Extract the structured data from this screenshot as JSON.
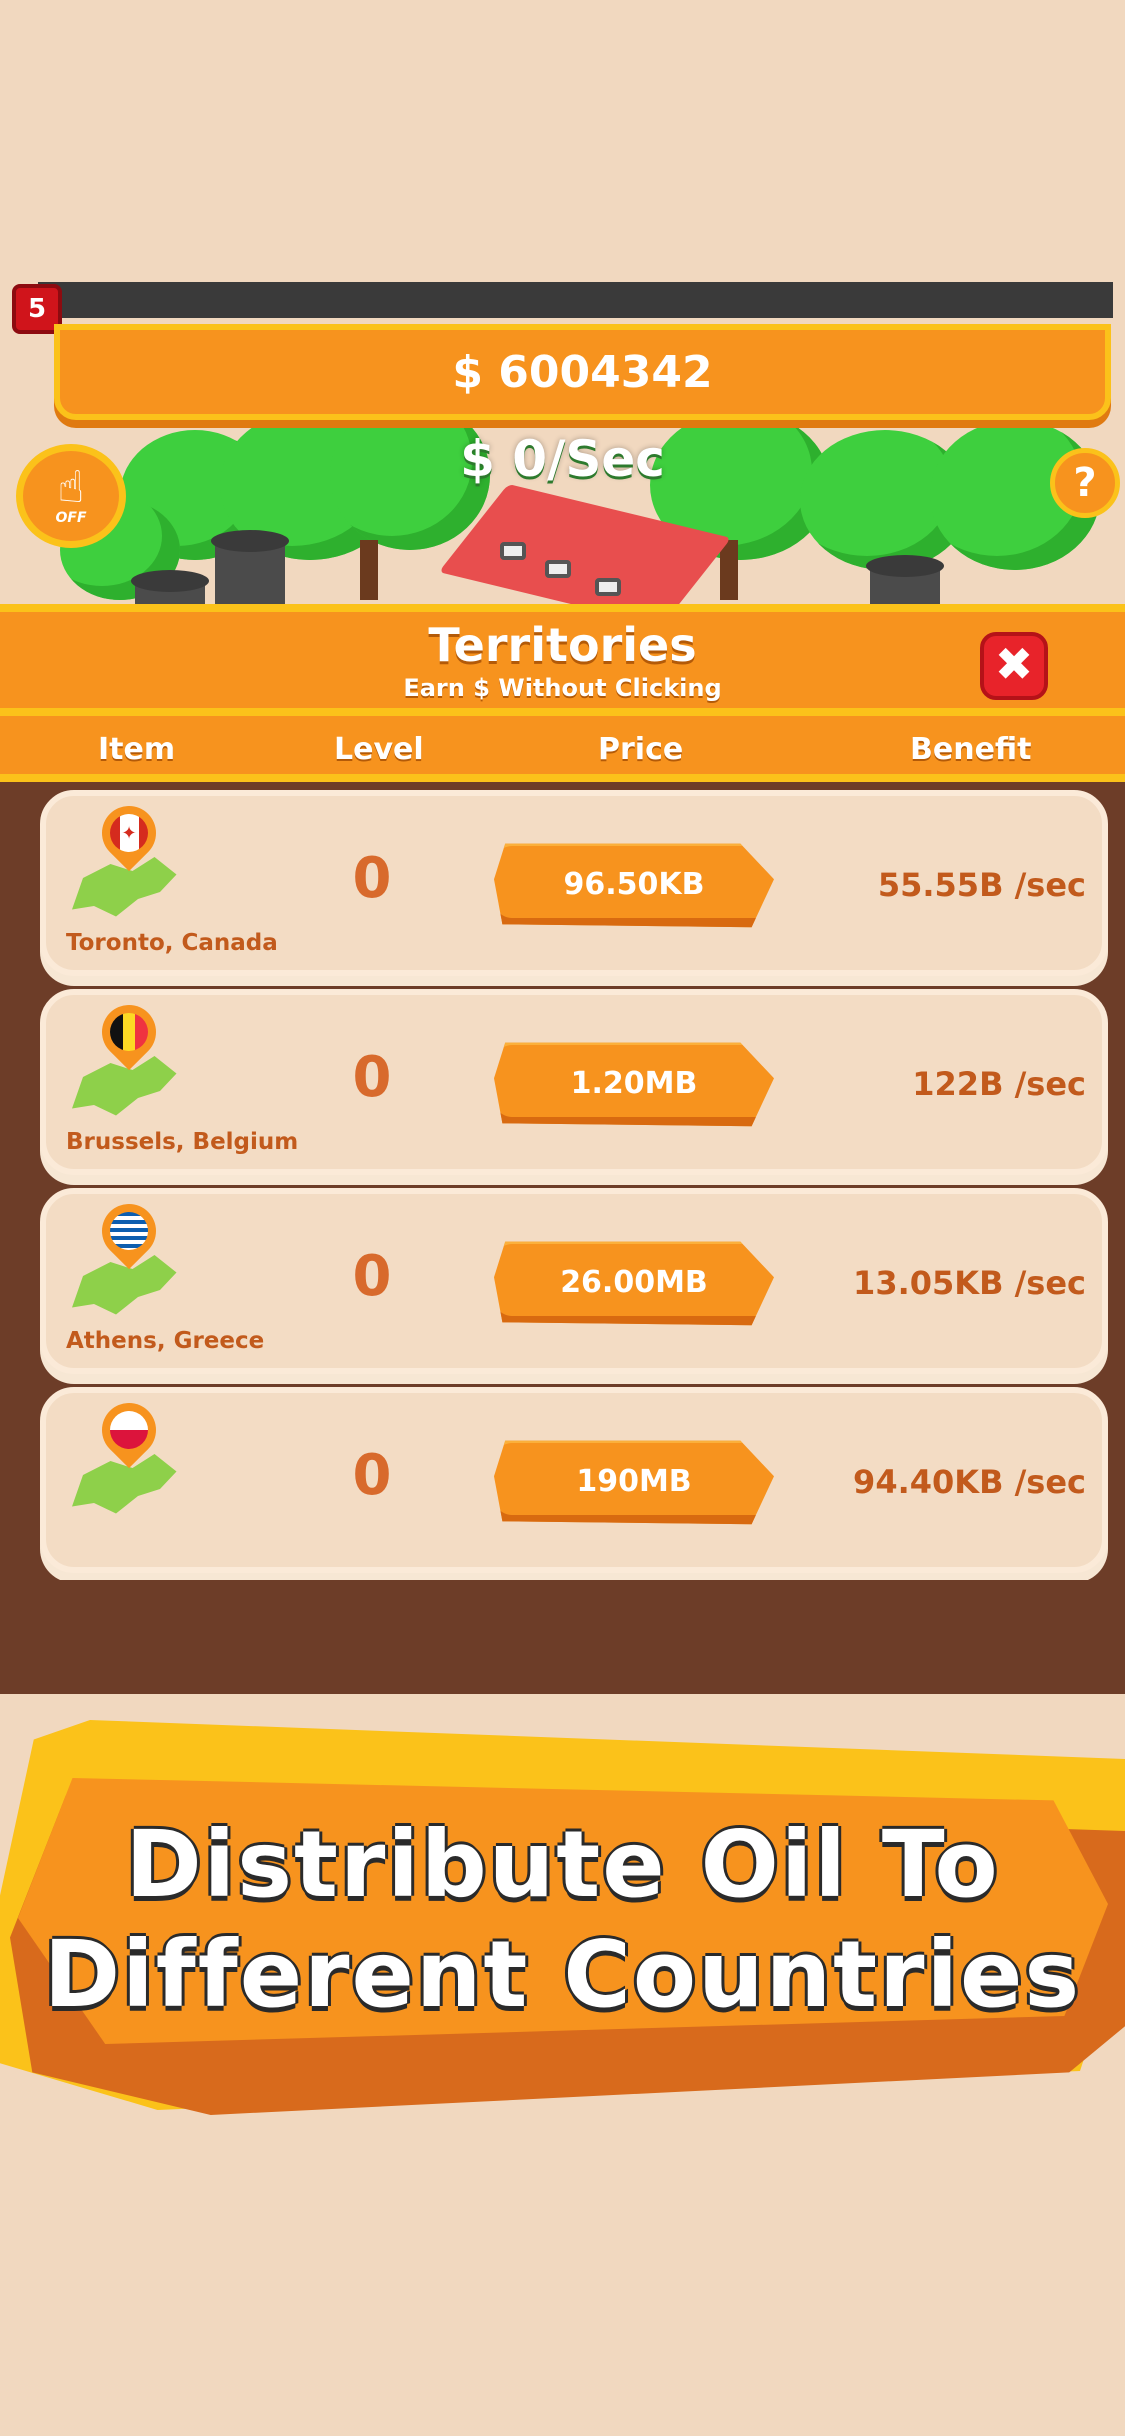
{
  "hud": {
    "level": "5",
    "money": "$ 6004342",
    "rate": "$ 0/Sec",
    "auto_click_state": "OFF",
    "help_label": "?"
  },
  "panel": {
    "title": "Territories",
    "subtitle": "Earn $ Without Clicking",
    "close_label": "✖",
    "columns": {
      "item": "Item",
      "level": "Level",
      "price": "Price",
      "benefit": "Benefit"
    }
  },
  "territories": [
    {
      "city": "Toronto, Canada",
      "level": "0",
      "price": "96.50KB",
      "benefit": "55.55B /sec",
      "flag": "canada"
    },
    {
      "city": "Brussels, Belgium",
      "level": "0",
      "price": "1.20MB",
      "benefit": "122B /sec",
      "flag": "belgium"
    },
    {
      "city": "Athens, Greece",
      "level": "0",
      "price": "26.00MB",
      "benefit": "13.05KB /sec",
      "flag": "greece"
    },
    {
      "city": "",
      "level": "0",
      "price": "190MB",
      "benefit": "94.40KB /sec",
      "flag": "poland"
    }
  ],
  "banner": {
    "line1": "Distribute Oil To",
    "line2": "Different Countries"
  },
  "colors": {
    "accent": "#f7931e",
    "accent_light": "#fbc21a",
    "panel_bg": "#6d3d28",
    "card_bg": "#f3dcc4",
    "text_brown": "#c25a1c",
    "close_red": "#e8232a"
  }
}
